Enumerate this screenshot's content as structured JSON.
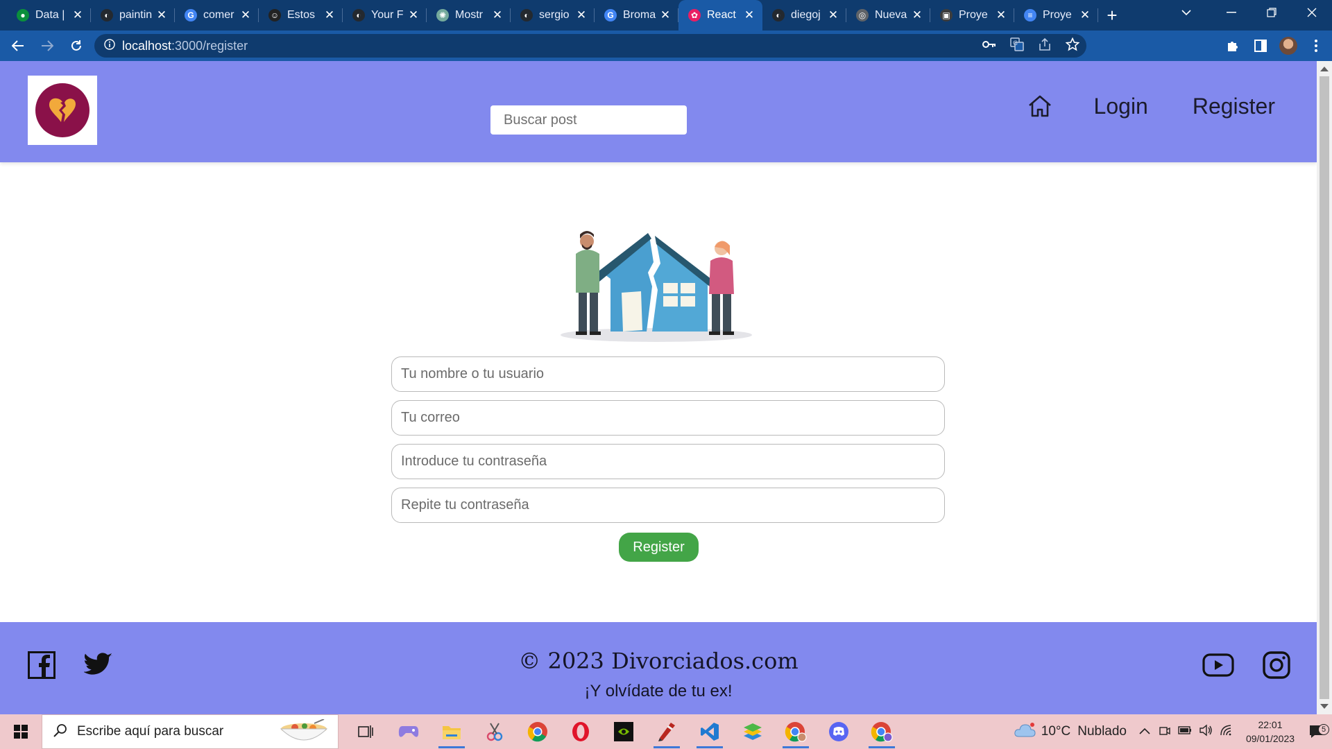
{
  "browser": {
    "tabs": [
      {
        "title": "Data |",
        "fav_color": "#0b8f3c",
        "fav_glyph": "●"
      },
      {
        "title": "paintin",
        "fav_color": "#24292f",
        "fav_glyph": "◐"
      },
      {
        "title": "comer",
        "fav_color": "#4285f4",
        "fav_glyph": "G"
      },
      {
        "title": "Estos",
        "fav_color": "#222222",
        "fav_glyph": "☺"
      },
      {
        "title": "Your F",
        "fav_color": "#24292f",
        "fav_glyph": "◐"
      },
      {
        "title": "Mostr",
        "fav_color": "#74aa9c",
        "fav_glyph": "✺"
      },
      {
        "title": "sergio",
        "fav_color": "#24292f",
        "fav_glyph": "◐"
      },
      {
        "title": "Broma",
        "fav_color": "#4285f4",
        "fav_glyph": "G"
      },
      {
        "title": "React",
        "fav_color": "#e91e63",
        "fav_glyph": "✿",
        "active": true
      },
      {
        "title": "diegoj",
        "fav_color": "#24292f",
        "fav_glyph": "◐"
      },
      {
        "title": "Nueva",
        "fav_color": "#5f6368",
        "fav_glyph": "◎"
      },
      {
        "title": "Proye",
        "fav_color": "#3c3c3c",
        "fav_glyph": "▣"
      },
      {
        "title": "Proye",
        "fav_color": "#4285f4",
        "fav_glyph": "≡"
      }
    ],
    "url_host": "localhost",
    "url_path": ":3000/register"
  },
  "site": {
    "search_placeholder": "Buscar post",
    "nav": {
      "login": "Login",
      "register": "Register"
    },
    "form": {
      "name_placeholder": "Tu nombre o tu usuario",
      "email_placeholder": "Tu correo",
      "password_placeholder": "Introduce tu contraseña",
      "repeat_placeholder": "Repite tu contraseña",
      "submit_label": "Register"
    },
    "footer": {
      "copyright": "© 2023 Divorciados.com",
      "tagline": "¡Y olvídate de tu ex!"
    },
    "colors": {
      "header_bg": "#8289ee",
      "button_bg": "#43a547",
      "logo_bg": "#8a1149"
    }
  },
  "taskbar": {
    "search_placeholder": "Escribe aquí para buscar",
    "weather_temp": "10°C",
    "weather_desc": "Nublado",
    "time": "22:01",
    "date": "09/01/2023",
    "notification_count": "5"
  }
}
